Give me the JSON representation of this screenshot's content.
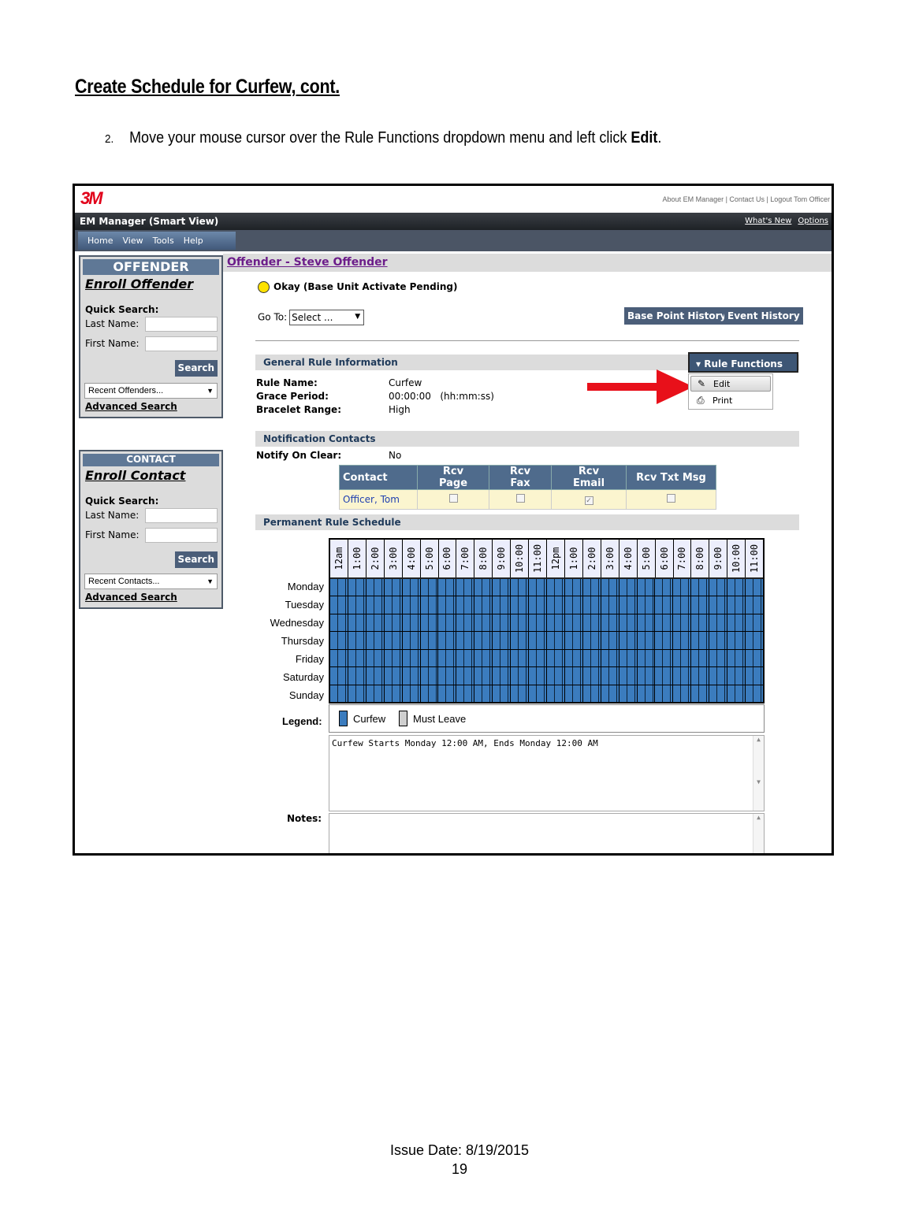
{
  "doc": {
    "title": "Create Schedule for Curfew, cont.",
    "step_number": "2.",
    "step_text_pre": "Move your mouse cursor over the Rule Functions dropdown menu and left click ",
    "step_text_bold": "Edit",
    "step_text_post": ".",
    "issue_date": "Issue Date: 8/19/2015",
    "page_number": "19"
  },
  "app": {
    "logo": "3M",
    "top_links": "About EM Manager | Contact Us | Logout Tom Officer",
    "title": "EM Manager (Smart View)",
    "whats_new": "What's New",
    "options": "Options",
    "nav": [
      "Home",
      "View",
      "Tools",
      "Help"
    ]
  },
  "offender_panel": {
    "header": "OFFENDER",
    "enroll": "Enroll Offender",
    "quick_search": "Quick Search:",
    "last_name": "Last Name:",
    "first_name": "First Name:",
    "search": "Search",
    "recent": "Recent Offenders...",
    "advanced": "Advanced Search"
  },
  "contact_panel": {
    "header": "CONTACT",
    "enroll": "Enroll Contact",
    "quick_search": "Quick Search:",
    "last_name": "Last Name:",
    "first_name": "First Name:",
    "search": "Search",
    "recent": "Recent Contacts...",
    "advanced": "Advanced Search"
  },
  "main": {
    "offender_title": "Offender - Steve Offender",
    "status": "Okay (Base Unit Activate Pending)",
    "status_color": "#ffe200",
    "goto_label": "Go To:",
    "goto_value": "Select ...",
    "base_point_history": "Base Point History",
    "event_history": "Event History",
    "general_rule_info": "General Rule Information",
    "rule_functions": "Rule Functions",
    "menu_items": [
      {
        "label": "Edit",
        "icon": "pencil-icon"
      },
      {
        "label": "Print",
        "icon": "printer-icon"
      }
    ],
    "rule_name_label": "Rule Name:",
    "rule_name": "Curfew",
    "grace_label": "Grace Period:",
    "grace_value": "00:00:00",
    "grace_unit": "(hh:mm:ss)",
    "bracelet_label": "Bracelet Range:",
    "bracelet_value": "High",
    "notification_contacts": "Notification Contacts",
    "notify_label": "Notify On Clear:",
    "notify_value": "No",
    "contact_headers": [
      "Contact",
      "Rcv Page",
      "Rcv Fax",
      "Rcv Email",
      "Rcv Txt Msg"
    ],
    "contact_row": {
      "name": "Officer, Tom",
      "page": false,
      "fax": false,
      "email": true,
      "txt": false
    },
    "permanent_schedule": "Permanent Rule Schedule",
    "hours": [
      "12am",
      "1:00",
      "2:00",
      "3:00",
      "4:00",
      "5:00",
      "6:00",
      "7:00",
      "8:00",
      "9:00",
      "10:00",
      "11:00",
      "12pm",
      "1:00",
      "2:00",
      "3:00",
      "4:00",
      "5:00",
      "6:00",
      "7:00",
      "8:00",
      "9:00",
      "10:00",
      "11:00"
    ],
    "days": [
      "Monday",
      "Tuesday",
      "Wednesday",
      "Thursday",
      "Friday",
      "Saturday",
      "Sunday"
    ],
    "legend_label": "Legend:",
    "legend_curfew": "Curfew",
    "legend_must_leave": "Must Leave",
    "curfew_color": "#3b7cbe",
    "schedule_text": "Curfew Starts Monday 12:00 AM, Ends Monday 12:00 AM",
    "notes_label": "Notes:"
  }
}
